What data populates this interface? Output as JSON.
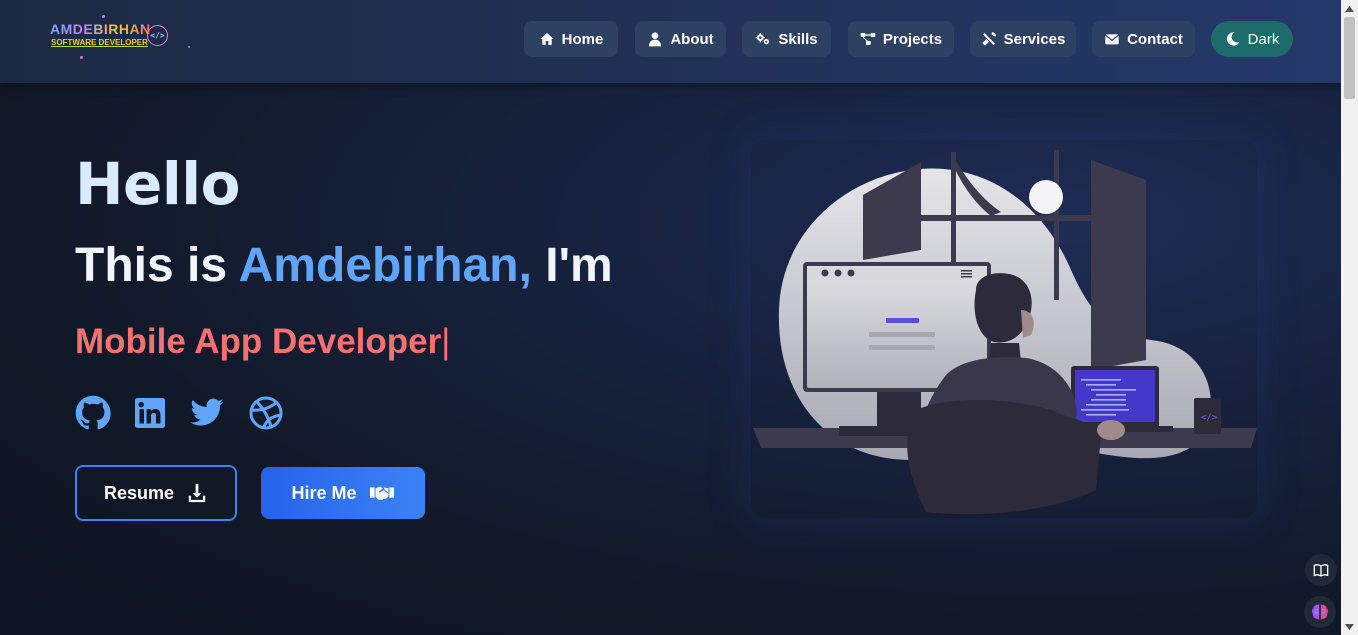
{
  "logo": {
    "name": "AMDEBIRHAN",
    "subtitle": "SOFTWARE DEVELOPER",
    "badge": "</>"
  },
  "nav": {
    "home": "Home",
    "about": "About",
    "skills": "Skills",
    "projects": "Projects",
    "services": "Services",
    "contact": "Contact",
    "theme": "Dark"
  },
  "hero": {
    "greeting": "Hello",
    "intro_prefix": "This is ",
    "intro_name": "Amdebirhan,",
    "intro_suffix": " I'm",
    "role": "Mobile App Developer",
    "cursor": "|",
    "resume_label": "Resume",
    "hire_label": "Hire Me"
  },
  "socials": [
    "github-icon",
    "linkedin-icon",
    "twitter-icon",
    "dribbble-icon"
  ],
  "colors": {
    "accent": "#60a5fa",
    "role": "#f87171",
    "nav_button": "#2f4163",
    "theme_button": "#1d6b6b",
    "hire_button": "#2563eb"
  }
}
